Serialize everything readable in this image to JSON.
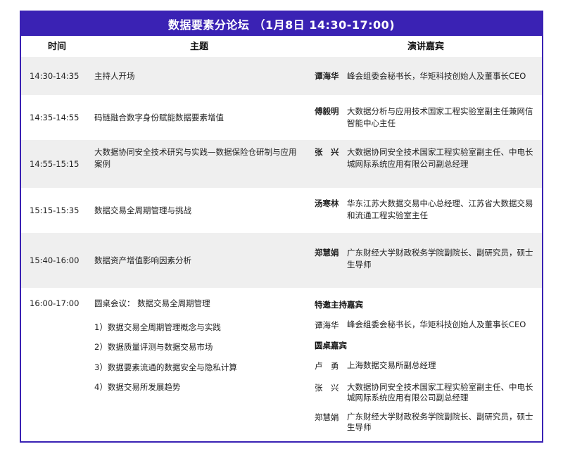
{
  "title": "数据要素分论坛 （1月8日 14:30-17:00)",
  "headers": {
    "time": "时间",
    "topic": "主题",
    "speaker": "演讲嘉宾"
  },
  "rows": [
    {
      "time": "14:30-14:35",
      "topic": "主持人开场",
      "name": "谭海华",
      "role": "峰会组委会秘书长，华矩科技创始人及董事长CEO"
    },
    {
      "time": "14:35-14:55",
      "topic": "码链融合数字身份赋能数据要素增值",
      "name": "傅毅明",
      "role": "大数据分析与应用技术国家工程实验室副主任兼网信智能中心主任"
    },
    {
      "time": "14:55-15:15",
      "topic": "大数据协同安全技术研究与实践—数据保险仓研制与应用案例",
      "name": "张　兴",
      "role": "大数据协同安全技术国家工程实验室副主任、中电长城网际系统应用有限公司副总经理"
    },
    {
      "time": "15:15-15:35",
      "topic": "数据交易全周期管理与挑战",
      "name": "汤寒林",
      "role": "华东江苏大数据交易中心总经理、江苏省大数据交易和流通工程实验室主任"
    },
    {
      "time": "15:40-16:00",
      "topic": "数据资产增值影响因素分析",
      "name": "郑慧娟",
      "role": "广东财经大学财政税务学院副院长、副研究员，硕士生导师"
    }
  ],
  "roundtable": {
    "time": "16:00-17:00",
    "topic": "圆桌会议： 数据交易全周期管理",
    "items": [
      "1）数据交易全周期管理概念与实践",
      "2）数据质量评测与数据交易市场",
      "3）数据要素流通的数据安全与隐私计算",
      "4）数据交易所发展趋势"
    ],
    "host_heading": "特邀主持嘉宾",
    "host": {
      "name": "谭海华",
      "role": "峰会组委会秘书长，华矩科技创始人及董事长CEO"
    },
    "guests_heading": "圆桌嘉宾",
    "guests": [
      {
        "name": "卢　勇",
        "role": "上海数据交易所副总经理"
      },
      {
        "name": "张　兴",
        "role": "大数据协同安全技术国家工程实验室副主任、中电长城网际系统应用有限公司副总经理"
      },
      {
        "name": "郑慧娟",
        "role": "广东财经大学财政税务学院副院长、副研究员，硕士生导师"
      }
    ]
  }
}
